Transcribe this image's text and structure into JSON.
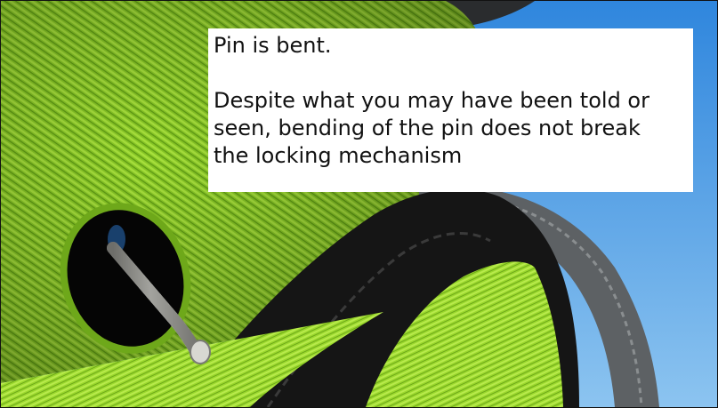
{
  "caption": {
    "line_1": "Pin is bent.",
    "line_2": "Despite what you may have been told or",
    "line_3": "seen, bending of the pin does not break",
    "line_4": "the locking mechanism"
  },
  "colors": {
    "fabric_green": "#8fd02a",
    "sky_blue": "#3f8fe0",
    "black_strap": "#151515",
    "grey_trim": "#5f6366",
    "pin_metal": "#b9b9b4"
  }
}
